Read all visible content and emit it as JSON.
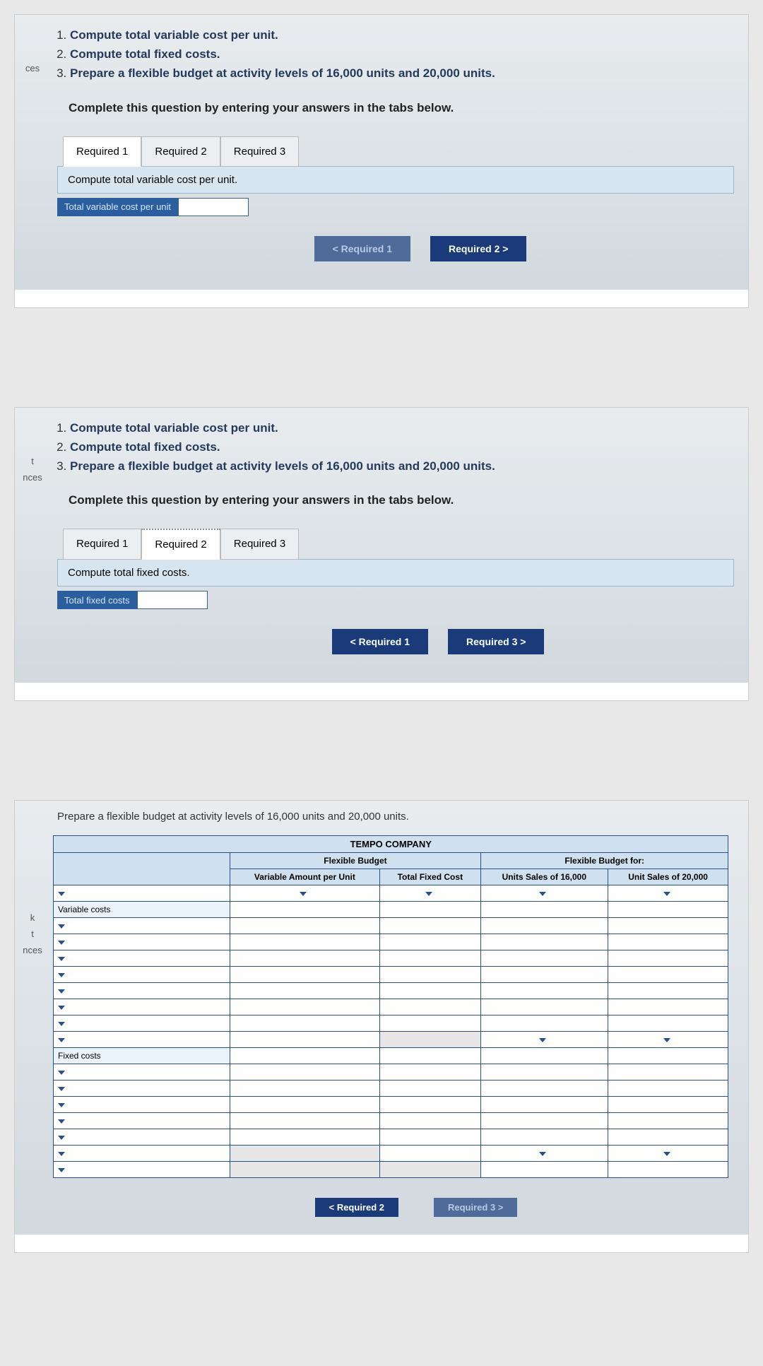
{
  "req_list": [
    "Compute total variable cost per unit.",
    "Compute total fixed costs.",
    "Prepare a flexible budget at activity levels of 16,000 units and 20,000 units."
  ],
  "instr": "Complete this question by entering your answers in the tabs below.",
  "tabs": [
    "Required 1",
    "Required 2",
    "Required 3"
  ],
  "panel1": {
    "sub": "Compute total variable cost per unit.",
    "label": "Total variable cost per unit",
    "prev": "<  Required 1",
    "next": "Required 2  >"
  },
  "panel2": {
    "sub": "Compute total fixed costs.",
    "label": "Total fixed costs",
    "prev": "<   Required 1",
    "next": "Required 3  >"
  },
  "panel3": {
    "instr": "Prepare a flexible budget at activity levels of 16,000 units and 20,000 units.",
    "company": "TEMPO COMPANY",
    "h_flex": "Flexible Budget",
    "h_for": "Flexible Budget for:",
    "h_var": "Variable Amount per Unit",
    "h_fix": "Total Fixed Cost",
    "h_u1": "Units Sales of 16,000",
    "h_u2": "Unit Sales of 20,000",
    "row_var": "Variable costs",
    "row_fix": "Fixed costs",
    "prev": "<  Required 2",
    "next": "Required 3  >"
  },
  "sidebar": {
    "a": "ces",
    "b": "t",
    "c": "nces",
    "d": "k",
    "e": "t"
  }
}
